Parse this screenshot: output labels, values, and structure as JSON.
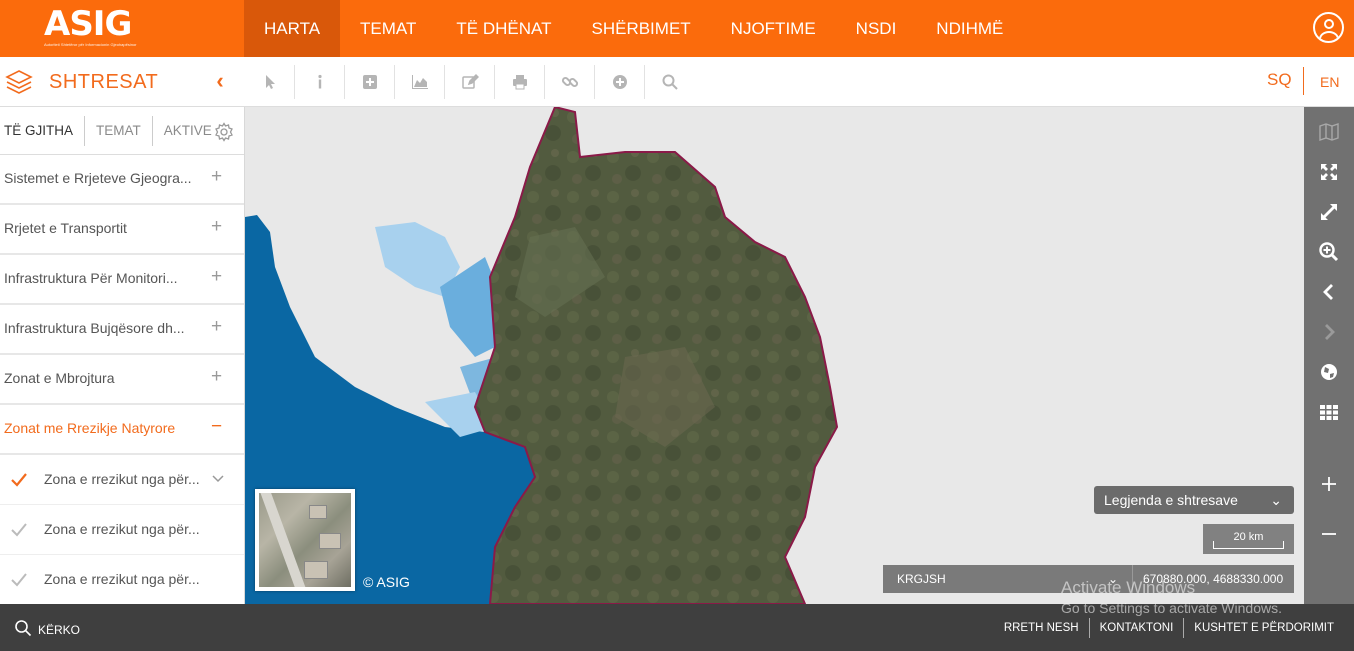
{
  "header": {
    "logo_text": "ASIG",
    "logo_tagline": "Autoriteti Shtetëror për Informacionin Gjeohapësinor",
    "nav": [
      {
        "label": "HARTA",
        "active": true
      },
      {
        "label": "TEMAT"
      },
      {
        "label": "TË DHËNAT"
      },
      {
        "label": "SHËRBIMET"
      },
      {
        "label": "NJOFTIME"
      },
      {
        "label": "NSDI"
      },
      {
        "label": "NDIHMË"
      }
    ]
  },
  "toolbar": {
    "panel_title": "SHTRESAT",
    "collapse_icon": "chevron-left-icon",
    "tools": [
      "pointer-icon",
      "info-icon",
      "add-square-icon",
      "chart-area-icon",
      "edit-icon",
      "print-icon",
      "link-icon",
      "plus-circle-icon",
      "search-icon"
    ],
    "lang_sq": "SQ",
    "lang_en": "EN"
  },
  "layers_panel": {
    "tabs": [
      "TË GJITHA",
      "TEMAT",
      "AKTIVE"
    ],
    "groups": [
      {
        "label": "Sistemet e Rrjeteve Gjeogra...",
        "toggle": "+"
      },
      {
        "label": "Rrjetet e Transportit",
        "toggle": "+"
      },
      {
        "label": "Infrastruktura Për Monitori...",
        "toggle": "+"
      },
      {
        "label": "Infrastruktura Bujqësore dh...",
        "toggle": "+"
      },
      {
        "label": "Zonat e Mbrojtura",
        "toggle": "+"
      },
      {
        "label": "Zonat me Rrezikje Natyrore",
        "toggle": "−"
      }
    ],
    "sublayers": [
      {
        "label": "Zona e rrezikut nga për...",
        "active": true
      },
      {
        "label": "Zona e rrezikut nga për...",
        "active": false
      },
      {
        "label": "Zona e rrezikut nga për...",
        "active": false
      }
    ]
  },
  "map": {
    "copyright": "© ASIG",
    "legend_label": "Legjenda e shtresave",
    "scale_label": "20 km",
    "crs": "KRGJSH",
    "coords": "670880.000, 4688330.000",
    "colors": {
      "sea": "#0a67a3",
      "lake": "#a8d1ee",
      "land": "#4f5a3c",
      "border": "#8a1a48",
      "accent": "#fb6b0c"
    }
  },
  "map_controls": [
    "map-icon",
    "fullscreen-icon",
    "expand-icon",
    "zoom-rect-icon",
    "back-icon",
    "forward-icon",
    "globe-icon",
    "grid-icon",
    "zoom-in-icon",
    "zoom-out-icon"
  ],
  "footer": {
    "search_label": "KËRKO",
    "links": [
      "RRETH NESH",
      "KONTAKTONI",
      "KUSHTET E PËRDORIMIT"
    ]
  },
  "watermark": {
    "line1": "Activate Windows",
    "line2": "Go to Settings to activate Windows."
  }
}
